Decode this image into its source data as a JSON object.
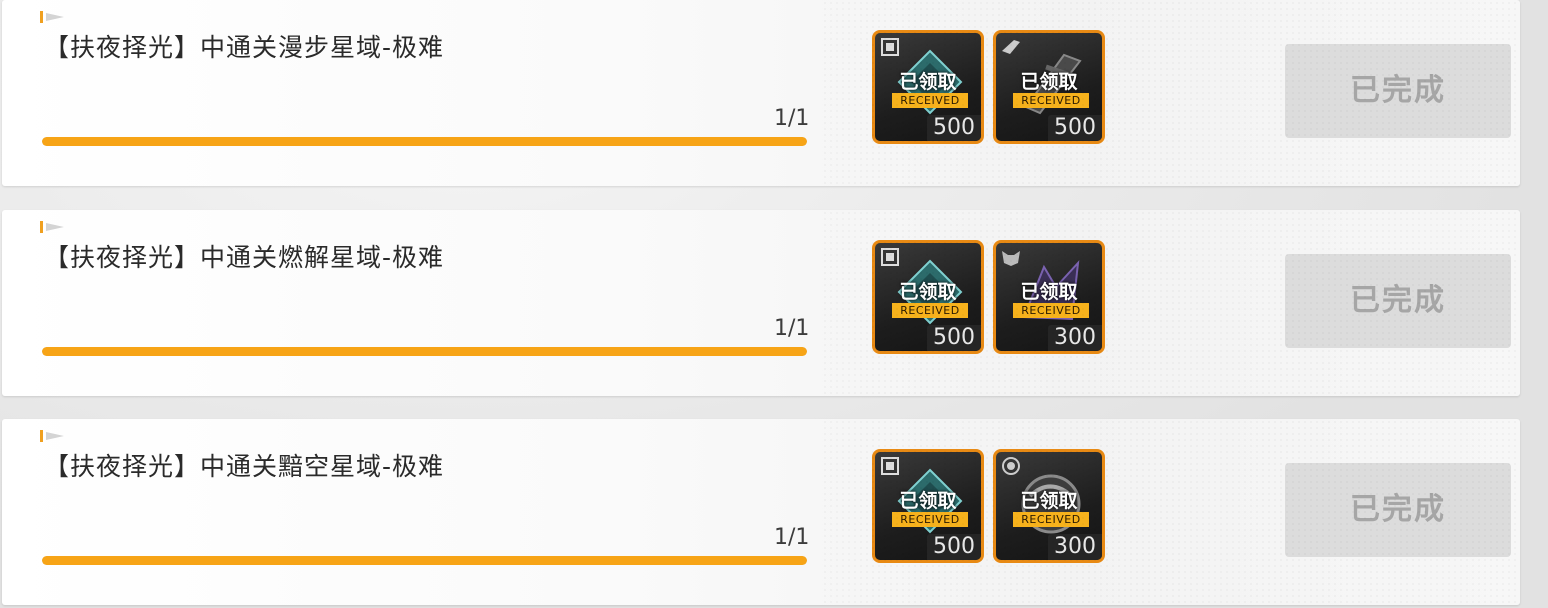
{
  "quests": [
    {
      "title": "【扶夜择光】中通关漫步星域-极难",
      "progress_text": "1/1",
      "progress": 1.0,
      "rewards": [
        {
          "icon": "chip-icon",
          "claimed_label": "已领取",
          "badge": "RECEIVED",
          "amount": "500"
        },
        {
          "icon": "weapon-icon",
          "claimed_label": "已领取",
          "badge": "RECEIVED",
          "amount": "500"
        }
      ],
      "status_label": "已完成"
    },
    {
      "title": "【扶夜择光】中通关燃解星域-极难",
      "progress_text": "1/1",
      "progress": 1.0,
      "rewards": [
        {
          "icon": "chip-icon",
          "claimed_label": "已领取",
          "badge": "RECEIVED",
          "amount": "500"
        },
        {
          "icon": "wolf-icon",
          "claimed_label": "已领取",
          "badge": "RECEIVED",
          "amount": "300"
        }
      ],
      "status_label": "已完成"
    },
    {
      "title": "【扶夜择光】中通关黯空星域-极难",
      "progress_text": "1/1",
      "progress": 1.0,
      "rewards": [
        {
          "icon": "chip-icon",
          "claimed_label": "已领取",
          "badge": "RECEIVED",
          "amount": "500"
        },
        {
          "icon": "orb-icon",
          "claimed_label": "已领取",
          "badge": "RECEIVED",
          "amount": "300"
        }
      ],
      "status_label": "已完成"
    }
  ],
  "colors": {
    "accent": "#f7a416",
    "reward_border": "#e88a14",
    "badge": "#f7b21c",
    "done_button_bg": "#dcdcdc",
    "done_button_text": "#a6a6a6"
  }
}
